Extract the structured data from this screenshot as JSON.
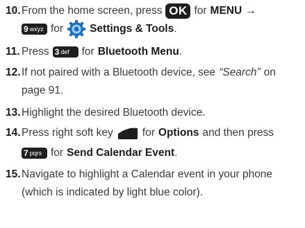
{
  "steps": [
    {
      "num": "10.",
      "t1": "From the home screen, press",
      "key1": "OK",
      "t2": "for",
      "b1": "MENU",
      "arrow": "→",
      "key2_digit": "9",
      "key2_letters": "wxyz",
      "t3": "for",
      "icon": "settings-tools-icon",
      "b2": "Settings & Tools",
      "end": "."
    },
    {
      "num": "11.",
      "t1": "Press",
      "key_digit": "3",
      "key_letters": "def",
      "t2": "for",
      "b1": "Bluetooth Menu",
      "end": "."
    },
    {
      "num": "12.",
      "line1": "If not paired with a Bluetooth device, see",
      "ref": "“Search”",
      "line1_end": "on",
      "line2": "page 91."
    },
    {
      "num": "13.",
      "text": "Highlight the desired Bluetooth device."
    },
    {
      "num": "14.",
      "t1": "Press right soft key",
      "icon": "right-soft-key-icon",
      "t2": "for",
      "b1": "Options",
      "t3": "and then press",
      "key_digit": "7",
      "key_letters": "pqrs",
      "t4": "for",
      "b2": "Send Calendar Event",
      "end": "."
    },
    {
      "num": "15.",
      "line1": "Navigate to highlight a Calendar event in your phone",
      "line2": "(which is indicated by light blue color)."
    }
  ]
}
